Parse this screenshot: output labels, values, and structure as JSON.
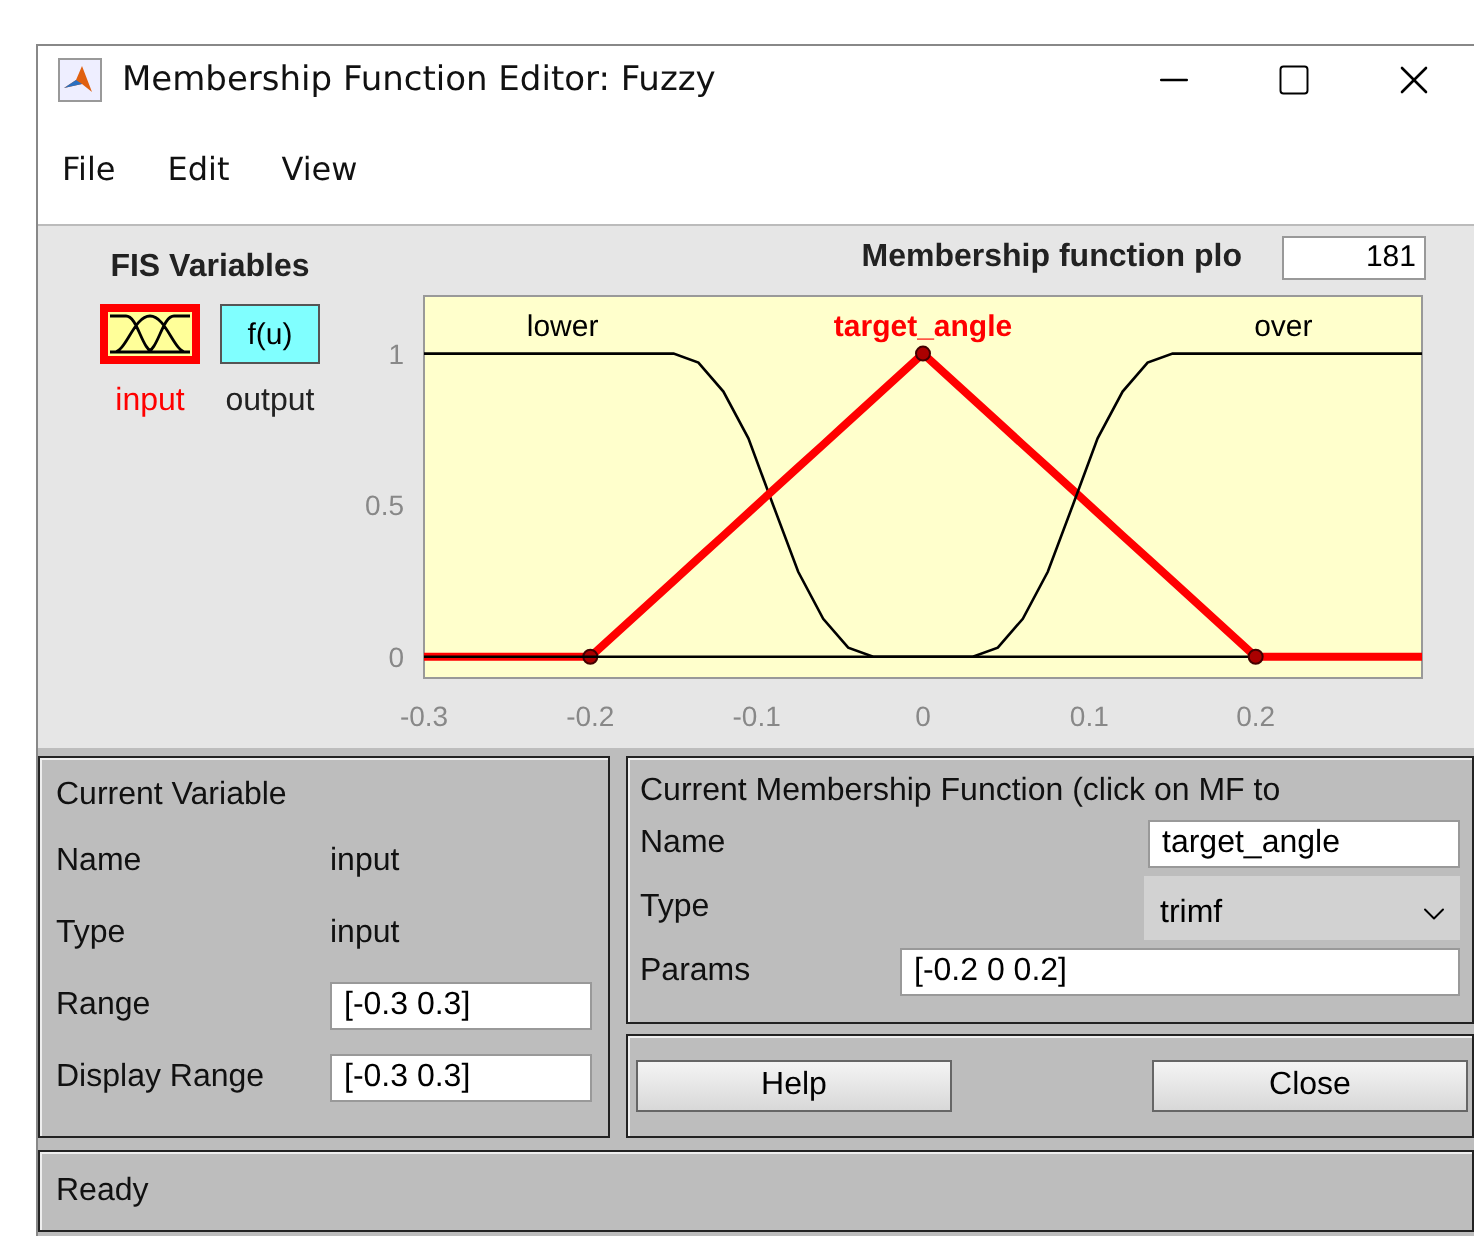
{
  "window": {
    "title": "Membership Function Editor: Fuzzy"
  },
  "menu": [
    "File",
    "Edit",
    "View"
  ],
  "fis_variables": {
    "title": "FIS Variables",
    "items": [
      {
        "kind": "input",
        "label": "input",
        "selected": true
      },
      {
        "kind": "output",
        "label": "output",
        "selected": false,
        "icon_text": "f(u)"
      }
    ]
  },
  "plot": {
    "title": "Membership function plo",
    "points_value": "181",
    "chart_data": {
      "type": "line",
      "x": [
        -0.3,
        -0.2,
        -0.15,
        -0.135,
        -0.12,
        -0.105,
        -0.09,
        -0.075,
        -0.06,
        -0.045,
        -0.03,
        0,
        0.03,
        0.045,
        0.06,
        0.075,
        0.09,
        0.105,
        0.12,
        0.135,
        0.15,
        0.2,
        0.3
      ],
      "series": [
        {
          "name": "lower",
          "color": "#000000",
          "values": [
            1,
            1,
            1,
            0.97,
            0.875,
            0.72,
            0.5,
            0.28,
            0.125,
            0.03,
            0,
            0,
            0,
            0,
            0,
            0,
            0,
            0,
            0,
            0,
            0,
            0,
            0
          ]
        },
        {
          "name": "target_angle",
          "color": "#ff0000",
          "values": [
            0,
            0,
            0.25,
            0.325,
            0.4,
            0.475,
            0.55,
            0.625,
            0.7,
            0.775,
            0.85,
            1,
            0.85,
            0.775,
            0.7,
            0.625,
            0.55,
            0.475,
            0.4,
            0.325,
            0.25,
            0,
            0
          ]
        },
        {
          "name": "over",
          "color": "#000000",
          "values": [
            0,
            0,
            0,
            0,
            0,
            0,
            0,
            0,
            0,
            0,
            0,
            0,
            0,
            0.03,
            0.125,
            0.28,
            0.5,
            0.72,
            0.875,
            0.97,
            1,
            1,
            1
          ]
        }
      ],
      "xlim": [
        -0.3,
        0.3
      ],
      "ylim": [
        -0.07,
        1.19
      ],
      "xticks": [
        -0.3,
        -0.2,
        -0.1,
        0,
        0.1,
        0.2
      ],
      "yticks": [
        0,
        0.5,
        1
      ]
    },
    "membership_functions": [
      {
        "selected": false
      },
      {
        "selected": true
      },
      {
        "selected": false
      }
    ]
  },
  "current_variable": {
    "title": "Current Variable",
    "rows": [
      {
        "kind": "text",
        "label": "Name",
        "value": "input"
      },
      {
        "kind": "text",
        "label": "Type",
        "value": "input"
      },
      {
        "kind": "field",
        "label": "Range",
        "value": "[-0.3 0.3]"
      },
      {
        "kind": "field",
        "label": "Display Range",
        "value": "[-0.3 0.3]"
      }
    ]
  },
  "current_mf": {
    "title": "Current Membership Function (click on MF to",
    "name_label": "Name",
    "name_value": "target_angle",
    "type_label": "Type",
    "type_value": "trimf",
    "params_label": "Params",
    "params_value": "[-0.2 0 0.2]"
  },
  "buttons": [
    "Help",
    "Close"
  ],
  "status_bar": "Ready"
}
